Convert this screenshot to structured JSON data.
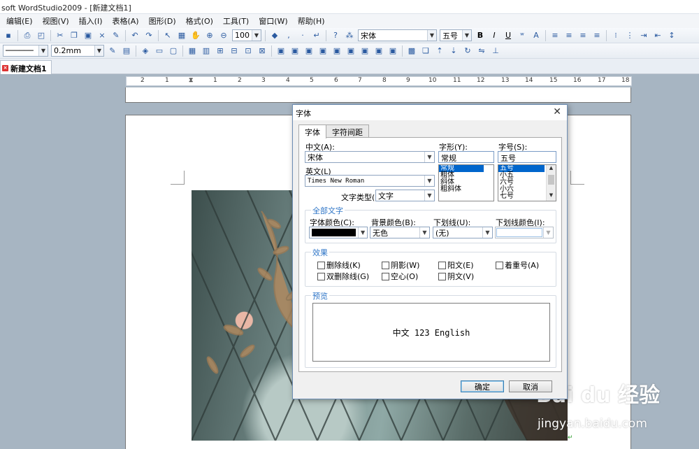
{
  "window": {
    "title": "soft WordStudio2009 - [新建文档1]"
  },
  "menu": [
    "编辑(E)",
    "视图(V)",
    "插入(I)",
    "表格(A)",
    "图形(D)",
    "格式(O)",
    "工具(T)",
    "窗口(W)",
    "帮助(H)"
  ],
  "toolbar": {
    "zoom": "100 %",
    "font_name": "宋体",
    "font_size": "五号",
    "line_width": "0.2mm",
    "bold": "B",
    "italic": "I",
    "underline": "U"
  },
  "document_tab": "新建文档1",
  "ruler": {
    "labels": [
      "2",
      "1",
      "1",
      "2",
      "3",
      "4",
      "5",
      "6",
      "7",
      "8",
      "9",
      "10",
      "11",
      "12",
      "13",
      "14",
      "15",
      "16",
      "17",
      "18"
    ]
  },
  "dialog": {
    "title": "字体",
    "tabs": [
      "字体",
      "字符间距"
    ],
    "chinese_label": "中文(A):",
    "chinese_value": "宋体",
    "english_label": "英文(L)",
    "english_value": "Times New Roman",
    "style_label": "字形(Y):",
    "style_value": "常规",
    "style_options": [
      "常规",
      "粗体",
      "斜体",
      "粗斜体"
    ],
    "size_label": "字号(S):",
    "size_value": "五号",
    "size_options": [
      "五号",
      "小五",
      "六号",
      "小六",
      "七号"
    ],
    "type_label": "文字类型(",
    "type_value": "文字",
    "all_text_group": "全部文字",
    "font_color_label": "字体颜色(C):",
    "bg_color_label": "背景颜色(B):",
    "bg_color_value": "无色",
    "underline_label": "下划线(U):",
    "underline_value": "(无)",
    "underline_color_label": "下划线颜色(I):",
    "effects_group": "效果",
    "effects": [
      "删除线(K)",
      "阴影(W)",
      "阳文(E)",
      "着重号(A)",
      "双删除线(G)",
      "空心(O)",
      "阴文(V)"
    ],
    "preview_group": "预览",
    "preview_text": "中文 123 English",
    "ok": "确定",
    "cancel": "取消"
  },
  "watermark": {
    "brand": "Bai du 经验",
    "url": "jingyan.baidu.com"
  },
  "colors": {
    "font_color": "#000000",
    "accent": "#2e75c7",
    "selection": "#0066cc"
  }
}
